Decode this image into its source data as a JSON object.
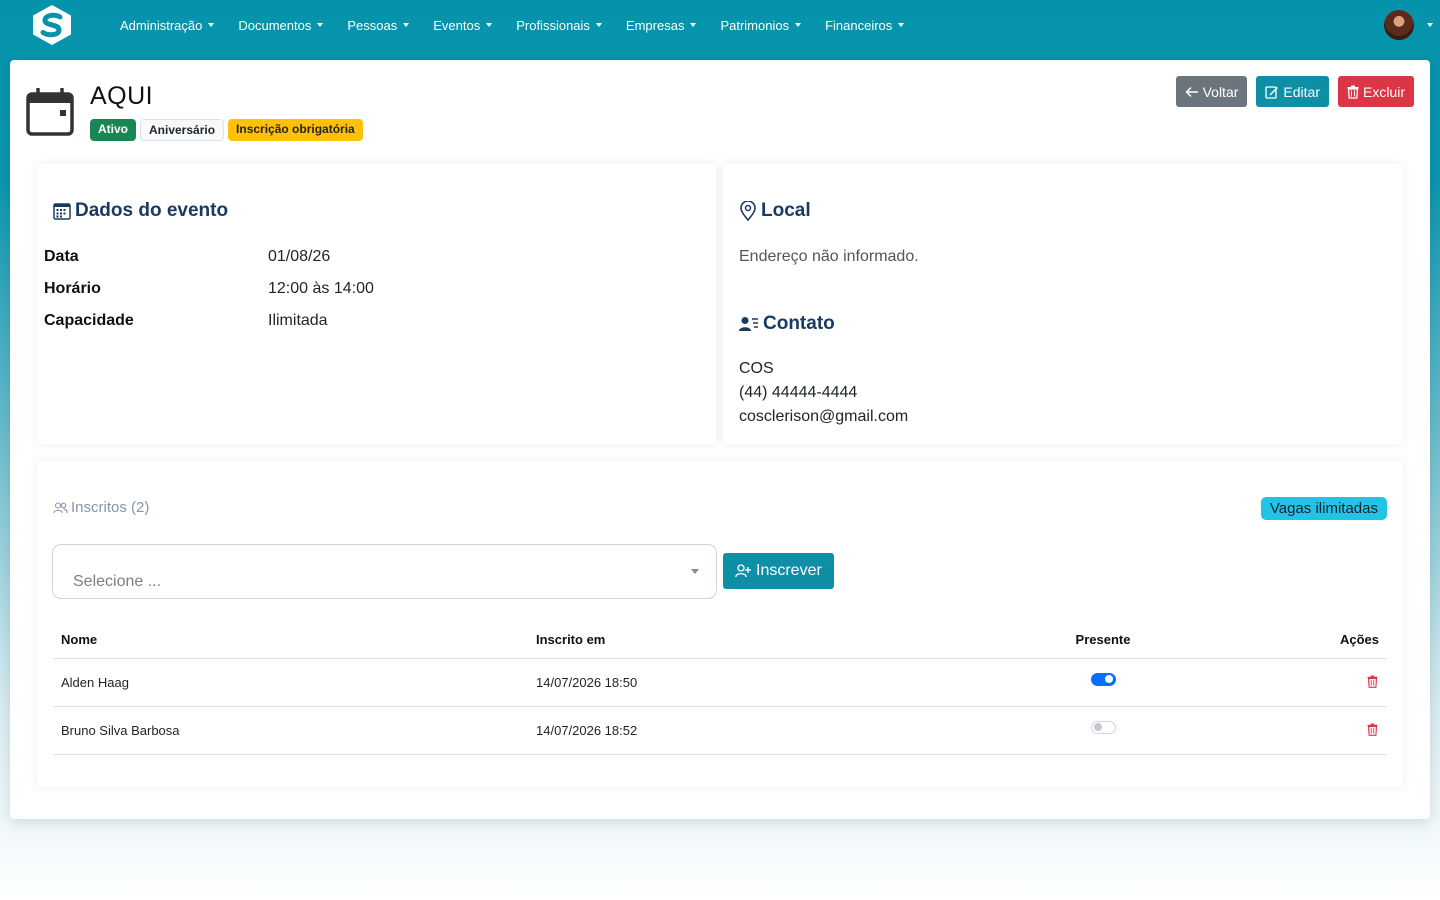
{
  "nav": {
    "items": [
      {
        "label": "Administração"
      },
      {
        "label": "Documentos"
      },
      {
        "label": "Pessoas"
      },
      {
        "label": "Eventos"
      },
      {
        "label": "Profissionais"
      },
      {
        "label": "Empresas"
      },
      {
        "label": "Patrimonios"
      },
      {
        "label": "Financeiros"
      }
    ]
  },
  "page": {
    "title": "AQUI",
    "badges": {
      "status": "Ativo",
      "type": "Aniversário",
      "requirement": "Inscrição obrigatória"
    },
    "buttons": {
      "back": "Voltar",
      "edit": "Editar",
      "delete": "Excluir"
    }
  },
  "dados_evento": {
    "heading": "Dados do evento",
    "rows": [
      {
        "label": "Data",
        "value": "01/08/26"
      },
      {
        "label": "Horário",
        "value": "12:00 às 14:00"
      },
      {
        "label": "Capacidade",
        "value": "Ilimitada"
      }
    ]
  },
  "local": {
    "heading": "Local",
    "text": "Endereço não informado."
  },
  "contato": {
    "heading": "Contato",
    "name": "COS",
    "phone": "(44) 44444-4444",
    "email": "cosclerison@gmail.com"
  },
  "inscritos": {
    "title": "Inscritos (2)",
    "vagas": "Vagas ilimitadas",
    "select_placeholder": "Selecione ...",
    "subscribe_button": "Inscrever",
    "columns": {
      "nome": "Nome",
      "inscrito_em": "Inscrito em",
      "presente": "Presente",
      "acoes": "Ações"
    },
    "rows": [
      {
        "nome": "Alden Haag",
        "inscrito_em": "14/07/2026 18:50",
        "presente": true
      },
      {
        "nome": "Bruno Silva Barbosa",
        "inscrito_em": "14/07/2026 18:52",
        "presente": false
      }
    ]
  },
  "colors": {
    "primary": "#0e8fa6",
    "danger": "#dc3545",
    "secondary": "#6c757d",
    "success": "#198754",
    "warning": "#ffc107",
    "info": "#23c3e6",
    "heading": "#1b3a63"
  }
}
